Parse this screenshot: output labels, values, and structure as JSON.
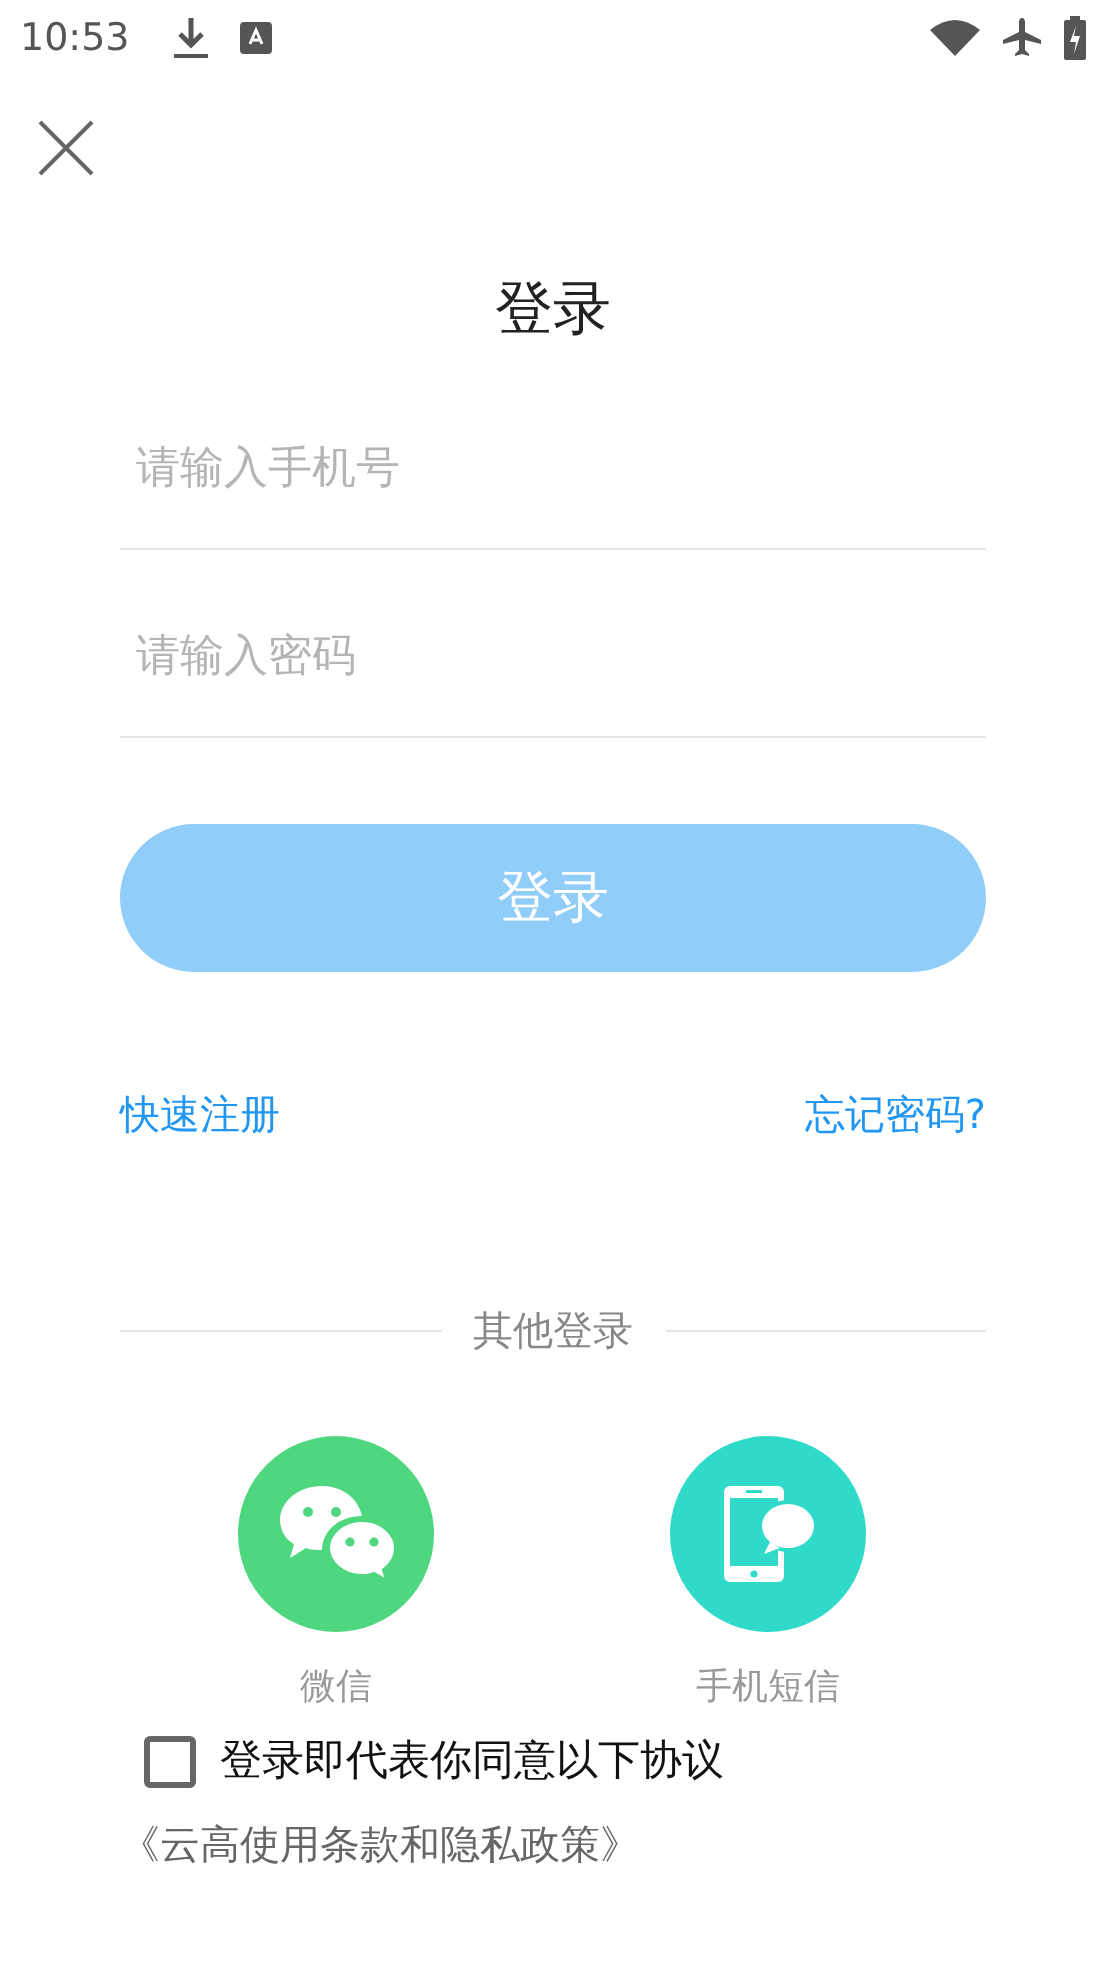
{
  "status_bar": {
    "time": "10:53"
  },
  "title": "登录",
  "fields": [
    {
      "placeholder": "请输入手机号"
    },
    {
      "placeholder": "请输入密码"
    }
  ],
  "login_button": {
    "label": "登录",
    "disabled": true
  },
  "links": [
    "快速注册",
    "忘记密码?"
  ],
  "other_login": {
    "label": "其他登录",
    "options": [
      {
        "kind": "wechat",
        "label": "微信",
        "color": "#4fd77f"
      },
      {
        "kind": "sms",
        "label": "手机短信",
        "color": "#2fdbc8"
      }
    ]
  },
  "agreement": {
    "checked": false,
    "text": "登录即代表你同意以下协议",
    "link": "《云高使用条款和隐私政策》"
  }
}
